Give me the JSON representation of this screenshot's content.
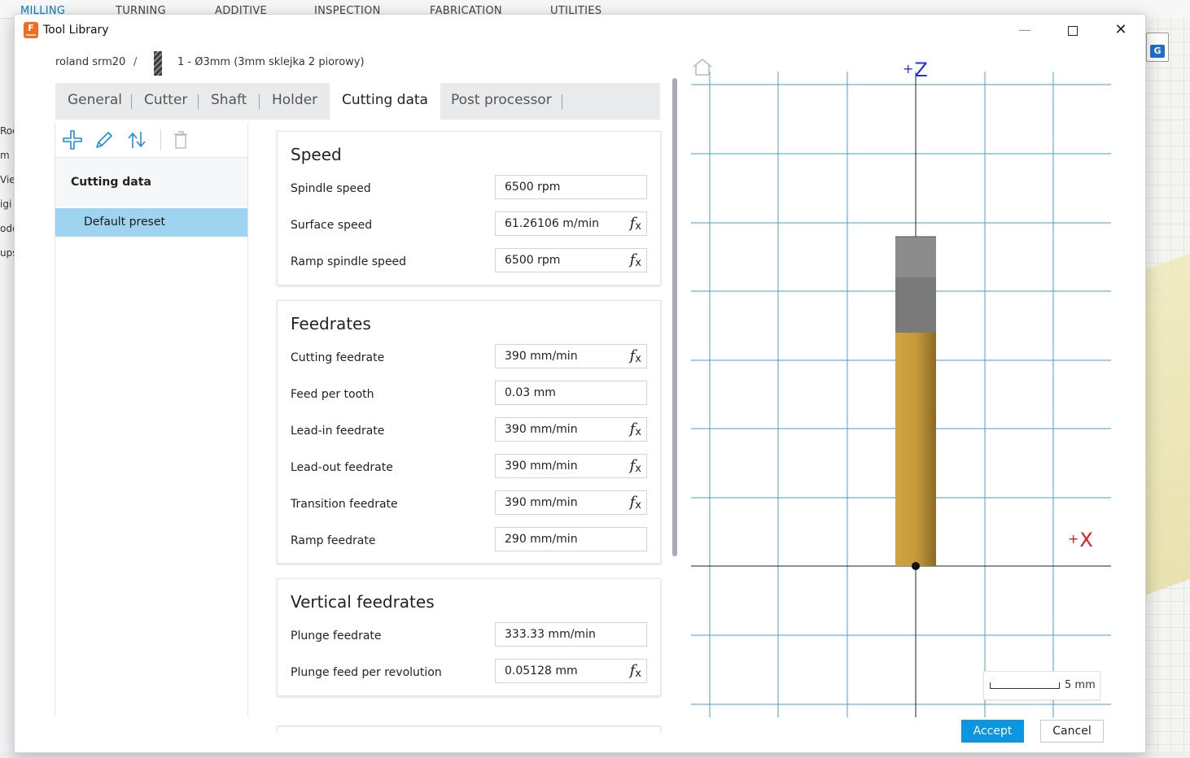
{
  "background": {
    "menu_tabs": [
      "MILLING",
      "TURNING",
      "ADDITIVE",
      "INSPECTION",
      "FABRICATION",
      "UTILITIES"
    ],
    "left_fragments": [
      "Roc",
      "m",
      "Vie",
      "igi",
      "ode",
      "ups"
    ],
    "g_icon": "G"
  },
  "titlebar": {
    "app_icon_letter": "F",
    "title": "Tool Library",
    "minimize": "—",
    "close": "✕"
  },
  "breadcrumb": {
    "machine": "roland srm20",
    "separator": "/",
    "tool": "1 - Ø3mm (3mm sklejka 2 piorowy)"
  },
  "tabs": [
    {
      "label": "General"
    },
    {
      "label": "Cutter"
    },
    {
      "label": "Shaft"
    },
    {
      "label": "Holder"
    },
    {
      "label": "Cutting data",
      "active": true
    },
    {
      "label": "Post processor"
    }
  ],
  "presets": {
    "toolbar_icons": [
      "add-icon",
      "edit-icon",
      "sort-icon",
      "delete-icon"
    ],
    "group_label": "Cutting data",
    "selected_item": "Default preset"
  },
  "sections": {
    "speed": {
      "title": "Speed",
      "fields": [
        {
          "label": "Spindle speed",
          "value": "6500 rpm",
          "fx": false
        },
        {
          "label": "Surface speed",
          "value": "61.26106 m/min",
          "fx": true
        },
        {
          "label": "Ramp spindle speed",
          "value": "6500 rpm",
          "fx": true
        }
      ]
    },
    "feedrates": {
      "title": "Feedrates",
      "fields": [
        {
          "label": "Cutting feedrate",
          "value": "390 mm/min",
          "fx": true
        },
        {
          "label": "Feed per tooth",
          "value": "0.03 mm",
          "fx": false
        },
        {
          "label": "Lead-in feedrate",
          "value": "390 mm/min",
          "fx": true
        },
        {
          "label": "Lead-out feedrate",
          "value": "390 mm/min",
          "fx": true
        },
        {
          "label": "Transition feedrate",
          "value": "390 mm/min",
          "fx": true
        },
        {
          "label": "Ramp feedrate",
          "value": "290 mm/min",
          "fx": false
        }
      ]
    },
    "vertical_feedrates": {
      "title": "Vertical feedrates",
      "fields": [
        {
          "label": "Plunge feedrate",
          "value": "333.33 mm/min",
          "fx": false
        },
        {
          "label": "Plunge feed per revolution",
          "value": "0.05128 mm",
          "fx": true
        }
      ]
    }
  },
  "fx_symbol": {
    "f": "f",
    "x": "x"
  },
  "preview": {
    "z_axis": "Z",
    "x_axis": "X",
    "plus": "+",
    "scale_label": "5 mm",
    "colors": {
      "grid": "#4a9fd4",
      "axis": "#222222",
      "holder_light": "#8c8c8c",
      "holder_dark": "#7a7a7a",
      "cutter": "#c59a3a",
      "z_color": "#2233dd",
      "x_color": "#e01a1a"
    }
  },
  "footer": {
    "accept": "Accept",
    "cancel": "Cancel"
  }
}
